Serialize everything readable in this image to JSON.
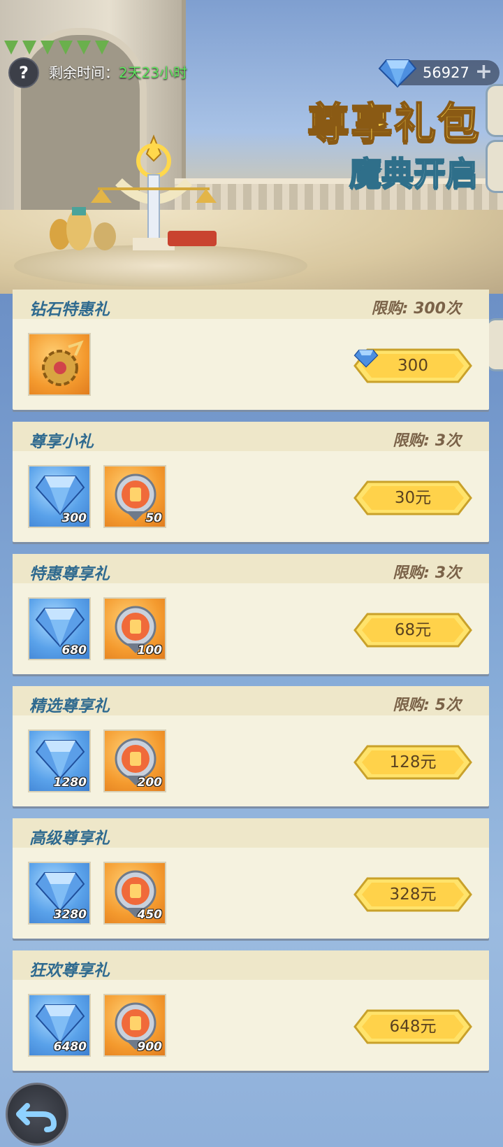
{
  "header": {
    "remaining_label": "剩余时间：",
    "remaining_value": "2天23小时",
    "gems": "56927",
    "title": "尊享礼包",
    "subtitle": "魔典开启"
  },
  "colors": {
    "accent_gold": "#ffd84c",
    "title_blue": "#2f6a8f",
    "time_green": "#5fe35f"
  },
  "packs": [
    {
      "title": "钻石特惠礼",
      "limit": "限购: 300次",
      "price": "300",
      "price_with_gem": true,
      "items": [
        {
          "type": "gear-relic",
          "qty": ""
        }
      ]
    },
    {
      "title": "尊享小礼",
      "limit": "限购: 3次",
      "price": "30元",
      "items": [
        {
          "type": "diamond",
          "qty": "300"
        },
        {
          "type": "medal",
          "qty": "50"
        }
      ]
    },
    {
      "title": "特惠尊享礼",
      "limit": "限购: 3次",
      "price": "68元",
      "items": [
        {
          "type": "diamond",
          "qty": "680"
        },
        {
          "type": "medal",
          "qty": "100"
        }
      ]
    },
    {
      "title": "精选尊享礼",
      "limit": "限购: 5次",
      "price": "128元",
      "items": [
        {
          "type": "diamond",
          "qty": "1280"
        },
        {
          "type": "medal",
          "qty": "200"
        }
      ]
    },
    {
      "title": "高级尊享礼",
      "limit": "",
      "price": "328元",
      "items": [
        {
          "type": "diamond",
          "qty": "3280"
        },
        {
          "type": "medal",
          "qty": "450"
        }
      ]
    },
    {
      "title": "狂欢尊享礼",
      "limit": "",
      "price": "648元",
      "items": [
        {
          "type": "diamond",
          "qty": "6480"
        },
        {
          "type": "medal",
          "qty": "900"
        }
      ]
    }
  ]
}
